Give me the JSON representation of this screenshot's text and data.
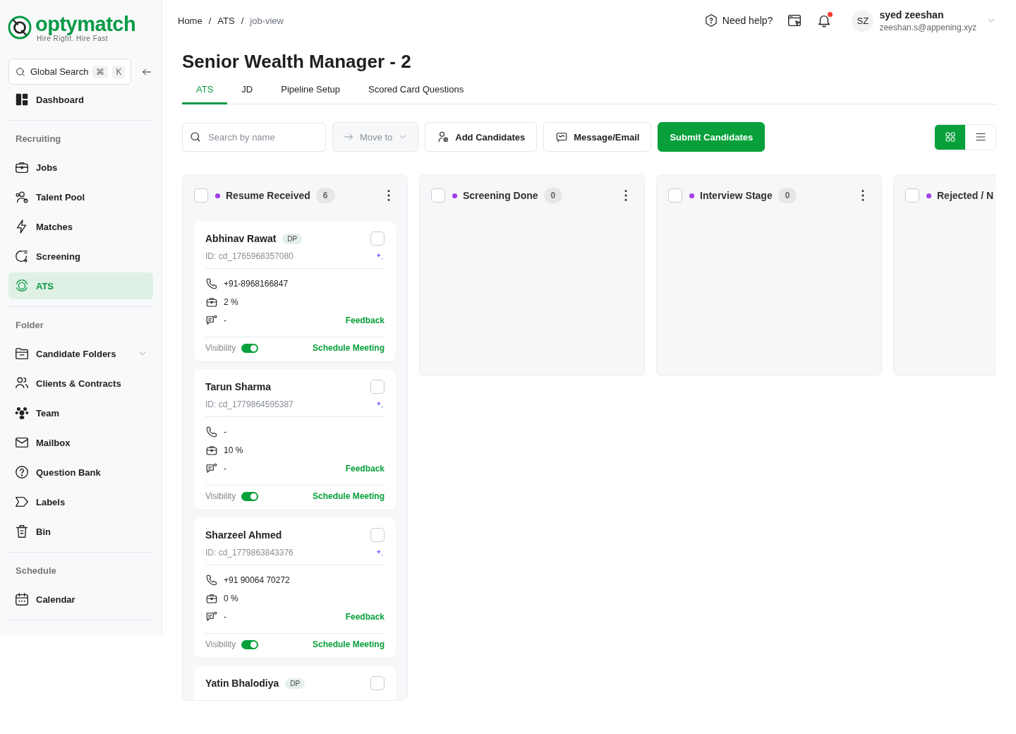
{
  "sidebar": {
    "logo": {
      "name": "optymatch",
      "tagline": "Hire Right. Hire Fast"
    },
    "search": {
      "placeholder": "Global Search",
      "keys": [
        "⌘",
        "K"
      ]
    },
    "sections": [
      {
        "items": [
          {
            "label": "Dashboard",
            "selected": false
          }
        ]
      },
      {
        "title": "Recruiting",
        "items": [
          {
            "label": "Jobs",
            "selected": false
          },
          {
            "label": "Talent Pool",
            "selected": false
          },
          {
            "label": "Matches",
            "selected": false
          },
          {
            "label": "Screening",
            "selected": false
          },
          {
            "label": "ATS",
            "selected": true
          }
        ]
      },
      {
        "title": "Folder",
        "items": [
          {
            "label": "Candidate Folders",
            "selected": false,
            "expanded": false
          },
          {
            "label": "Clients & Contracts",
            "selected": false
          },
          {
            "label": "Team",
            "selected": false
          },
          {
            "label": "Mailbox",
            "selected": false
          },
          {
            "label": "Question Bank",
            "selected": false
          },
          {
            "label": "Labels",
            "selected": false
          },
          {
            "label": "Bin",
            "selected": false
          }
        ]
      },
      {
        "title": "Schedule",
        "items": [
          {
            "label": "Calendar",
            "selected": false
          }
        ]
      }
    ]
  },
  "breadcrumb": {
    "items": [
      "Home",
      "ATS",
      "job-view"
    ],
    "separator": "/"
  },
  "header": {
    "help": "Need help?",
    "notification": true,
    "user": {
      "initials": "SZ",
      "name": "syed zeeshan",
      "email": "zeeshan.s@appening.xyz"
    }
  },
  "page_title": "Senior Wealth Manager - 2",
  "tabs": [
    {
      "label": "ATS",
      "selected": true
    },
    {
      "label": "JD",
      "selected": false
    },
    {
      "label": "Pipeline Setup",
      "selected": false
    },
    {
      "label": "Scored Card Questions",
      "selected": false
    }
  ],
  "toolbar": {
    "search": {
      "placeholder": "Search by name"
    },
    "move_to": {
      "label": "Move to",
      "disabled": true
    },
    "buttons": [
      {
        "label": "Add Candidates",
        "kind": "add"
      },
      {
        "label": "Message/Email",
        "kind": "message"
      },
      {
        "label": "Submit Candidates",
        "kind": "primary"
      }
    ],
    "views": [
      {
        "kind": "grid",
        "selected": true
      },
      {
        "kind": "list",
        "selected": false
      }
    ]
  },
  "columns": [
    {
      "title": "Resume Received",
      "color": "#a43ee8",
      "count": "6",
      "checked": false,
      "cards": [
        {
          "name": "Abhinav Rawat",
          "badge": "DP",
          "id": "ID: cd_1765968357080",
          "phone": "+91-8968166847",
          "score": "2 %",
          "feedback": "-",
          "feedback_link": "Feedback",
          "visibility_label": "Visibility",
          "visible": true,
          "meeting": "Schedule Meeting",
          "checked": false
        },
        {
          "name": "Tarun Sharma",
          "id": "ID: cd_1779864595387",
          "phone": "-",
          "score": "10 %",
          "feedback": "-",
          "feedback_link": "Feedback",
          "visibility_label": "Visibility",
          "visible": true,
          "meeting": "Schedule Meeting",
          "checked": false
        },
        {
          "name": "Sharzeel Ahmed",
          "id": "ID: cd_1779863843376",
          "phone": "+91 90064 70272",
          "score": "0 %",
          "feedback": "-",
          "feedback_link": "Feedback",
          "visibility_label": "Visibility",
          "visible": true,
          "meeting": "Schedule Meeting",
          "checked": false
        },
        {
          "name": "Yatin Bhalodiya",
          "badge": "DP",
          "checked": false
        }
      ]
    },
    {
      "title": "Screening Done",
      "color": "#a43ee8",
      "count": "0",
      "checked": false
    },
    {
      "title": "Interview Stage",
      "color": "#a43ee8",
      "count": "0",
      "checked": false
    },
    {
      "title": "Rejected / N",
      "color": "#a43ee8",
      "checked": false
    }
  ]
}
